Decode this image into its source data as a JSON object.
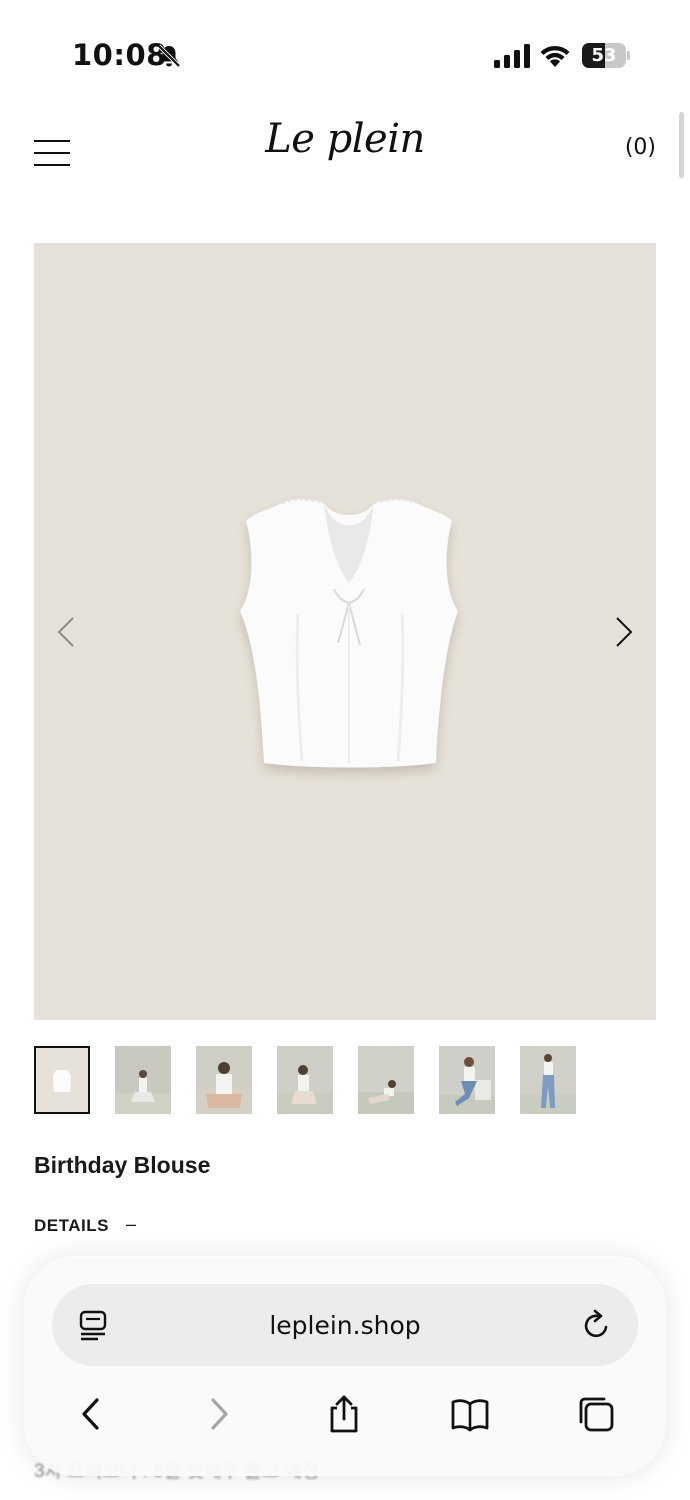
{
  "status_bar": {
    "time": "10:08",
    "battery_level": "53",
    "icons": [
      "bell-slash-icon",
      "signal-bars-icon",
      "wifi-icon",
      "battery-icon"
    ]
  },
  "header": {
    "logo": "Le plein",
    "cart_label": "(0)",
    "menu_icon": "hamburger-menu-icon"
  },
  "gallery": {
    "background_color": "#e7e2d9",
    "prev_icon": "chevron-left-icon",
    "next_icon": "chevron-right-icon",
    "thumbnail_count": 7,
    "active_thumbnail": 1
  },
  "product": {
    "title": "Birthday Blouse",
    "details_label": "DETAILS",
    "details_toggle": "–",
    "description_partial": "3차 프리오더 : 5월 첫째주 출고 예정"
  },
  "browser": {
    "url": "leplein.shop",
    "toolbar_icons": [
      "back-icon",
      "forward-icon",
      "share-icon",
      "bookmarks-icon",
      "tabs-icon"
    ]
  }
}
